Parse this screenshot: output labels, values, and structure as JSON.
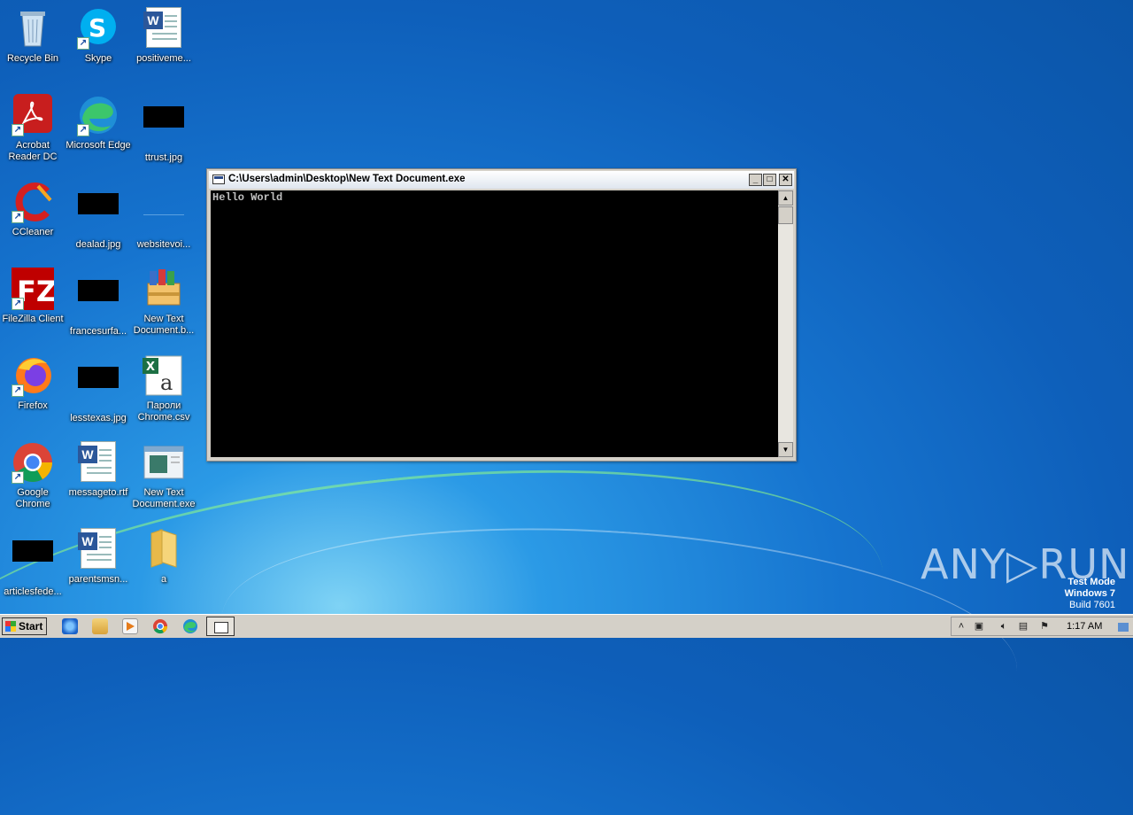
{
  "desktop": {
    "icons": [
      {
        "label": "Recycle Bin"
      },
      {
        "label": "Skype"
      },
      {
        "label": "positiveme..."
      },
      {
        "label": "Acrobat\nReader DC"
      },
      {
        "label": "Microsoft Edge"
      },
      {
        "label": "ttrust.jpg"
      },
      {
        "label": "CCleaner"
      },
      {
        "label": "dealad.jpg"
      },
      {
        "label": "websitevoi..."
      },
      {
        "label": "FileZilla Client"
      },
      {
        "label": "francesurfa..."
      },
      {
        "label": "New Text\nDocument.b..."
      },
      {
        "label": "Firefox"
      },
      {
        "label": "lesstexas.jpg"
      },
      {
        "label": "Пароли\nChrome.csv"
      },
      {
        "label": "Google\nChrome"
      },
      {
        "label": "messageto.rtf"
      },
      {
        "label": "New Text\nDocument.exe"
      },
      {
        "label": "articlesfede..."
      },
      {
        "label": "parentsmsn..."
      },
      {
        "label": "a"
      }
    ]
  },
  "console": {
    "title": "C:\\Users\\admin\\Desktop\\New Text Document.exe",
    "output": "Hello World",
    "minimize": "_",
    "maximize": "□",
    "close": "✕"
  },
  "taskbar": {
    "start_label": "Start",
    "clock": "1:17 AM"
  },
  "watermark": {
    "line1": "Test Mode",
    "line2": "Windows 7",
    "line3": "Build 7601",
    "brand": "ANY▷RUN"
  }
}
